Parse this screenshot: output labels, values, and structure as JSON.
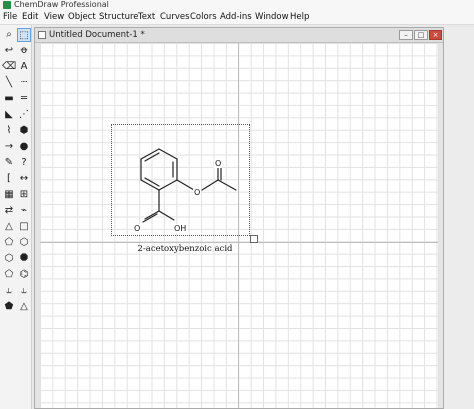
{
  "app": {
    "title": "ChemDraw Professional",
    "icon": "chemdraw-app-icon"
  },
  "menu": [
    "File",
    "Edit",
    "View",
    "Object",
    "Structure",
    "Text",
    "Curves",
    "Colors",
    "Add-ins",
    "Window",
    "Help"
  ],
  "document": {
    "title": "Untitled Document-1 *",
    "minimize": "–",
    "maximize": "□",
    "close": "×"
  },
  "palette": {
    "tools": [
      "lasso-icon",
      "marquee-select-icon",
      "structure-perspective-icon",
      "mass-fragmentation-icon",
      "eraser-icon",
      "text-tool-icon",
      "solid-bond-icon",
      "dashed-bond-icon",
      "bold-bond-icon",
      "multiple-bond-icon",
      "wedge-bond-icon",
      "hashed-wedge-bond-icon",
      "chain-tool-icon",
      "template-icon",
      "arrow-tool-icon",
      "orbital-icon",
      "pen-tool-icon",
      "query-tool-icon",
      "bracket-tool-icon",
      "atom-map-icon",
      "table-tool-icon",
      "tlc-plate-icon",
      "chemical-symbol-icon",
      "acyclic-chain-icon",
      "triangle-ring-icon",
      "square-ring-icon",
      "pentagon-ring-icon",
      "hexagon-ring-icon",
      "heptagon-ring-icon",
      "octagon-ring-icon",
      "cyclopentadiene-icon",
      "benzene-ring-icon",
      "chair-cyclohexane-icon",
      "chair-cyclohexane-alt-icon",
      "pentagon-ring-icon",
      "cyclopropane-icon"
    ],
    "glyphs": [
      "⌕",
      "⬚",
      "↩",
      "ꝋ",
      "⌫",
      "A",
      "╲",
      "┈",
      "▬",
      "═",
      "◣",
      "⋰",
      "⌇",
      "⬢",
      "→",
      "●",
      "✎",
      "?",
      "[",
      "↔",
      "▦",
      "⊞",
      "⇄",
      "⌁",
      "△",
      "□",
      "⬠",
      "⬡",
      "⬡",
      "⯃",
      "⬠",
      "⌬",
      "⥿",
      "⥿",
      "⬟",
      "△"
    ],
    "active_index": 1
  },
  "molecule": {
    "name": "2-acetoxybenzoic acid",
    "atoms": {
      "ester_o": "O",
      "carbonyl_o_top": "O",
      "acid_o": "O",
      "acid_oh": "OH"
    }
  }
}
